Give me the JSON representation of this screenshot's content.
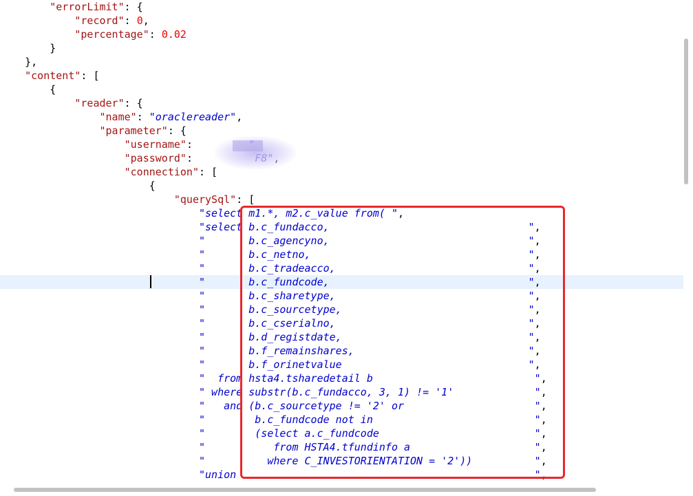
{
  "lines": [
    [
      {
        "t": "        "
      },
      {
        "c": "key",
        "t": "\"errorLimit\""
      },
      {
        "c": "punc",
        "t": ": {"
      }
    ],
    [
      {
        "t": "            "
      },
      {
        "c": "key",
        "t": "\"record\""
      },
      {
        "c": "punc",
        "t": ": "
      },
      {
        "c": "num",
        "t": "0"
      },
      {
        "c": "punc",
        "t": ","
      }
    ],
    [
      {
        "t": "            "
      },
      {
        "c": "key",
        "t": "\"percentage\""
      },
      {
        "c": "punc",
        "t": ": "
      },
      {
        "c": "num",
        "t": "0.02"
      }
    ],
    [
      {
        "t": "        "
      },
      {
        "c": "punc",
        "t": "}"
      }
    ],
    [
      {
        "t": "    "
      },
      {
        "c": "punc",
        "t": "},"
      }
    ],
    [
      {
        "t": "    "
      },
      {
        "c": "key",
        "t": "\"content\""
      },
      {
        "c": "punc",
        "t": ": ["
      }
    ],
    [
      {
        "t": "        "
      },
      {
        "c": "punc",
        "t": "{"
      }
    ],
    [
      {
        "t": "            "
      },
      {
        "c": "key",
        "t": "\"reader\""
      },
      {
        "c": "punc",
        "t": ": {"
      }
    ],
    [
      {
        "t": "                "
      },
      {
        "c": "key",
        "t": "\"name\""
      },
      {
        "c": "punc",
        "t": ": "
      },
      {
        "c": "str",
        "t": "\"oraclereader\""
      },
      {
        "c": "punc",
        "t": ","
      }
    ],
    [
      {
        "t": "                "
      },
      {
        "c": "key",
        "t": "\"parameter\""
      },
      {
        "c": "punc",
        "t": ": {"
      }
    ],
    [
      {
        "t": "                    "
      },
      {
        "c": "key",
        "t": "\"username\""
      },
      {
        "c": "punc",
        "t": ":"
      },
      {
        "t": "         "
      },
      {
        "c": "str",
        "t": "\""
      }
    ],
    [
      {
        "t": "                    "
      },
      {
        "c": "key",
        "t": "\"password\""
      },
      {
        "c": "punc",
        "t": ":"
      },
      {
        "t": "          "
      },
      {
        "c": "str",
        "t": "F8\""
      },
      {
        "c": "punc",
        "t": ","
      }
    ],
    [
      {
        "t": "                    "
      },
      {
        "c": "key",
        "t": "\"connection\""
      },
      {
        "c": "punc",
        "t": ": ["
      }
    ],
    [
      {
        "t": "                        "
      },
      {
        "c": "punc",
        "t": "{"
      }
    ],
    [
      {
        "t": "                            "
      },
      {
        "c": "key",
        "t": "\"querySql\""
      },
      {
        "c": "punc",
        "t": ": ["
      }
    ],
    [
      {
        "t": "                                "
      },
      {
        "c": "str",
        "t": "\"select m1.*, m2.c_value from( \""
      },
      {
        "c": "punc",
        "t": ","
      }
    ],
    [
      {
        "t": "                                "
      },
      {
        "c": "str",
        "t": "\"select b.c_fundacco,                                \""
      },
      {
        "c": "punc",
        "t": ","
      }
    ],
    [
      {
        "t": "                                "
      },
      {
        "c": "str",
        "t": "\"       b.c_agencyno,                                \""
      },
      {
        "c": "punc",
        "t": ","
      }
    ],
    [
      {
        "t": "                                "
      },
      {
        "c": "str",
        "t": "\"       b.c_netno,                                   \""
      },
      {
        "c": "punc",
        "t": ","
      }
    ],
    [
      {
        "t": "                                "
      },
      {
        "c": "str",
        "t": "\"       b.c_tradeacco,                               \""
      },
      {
        "c": "punc",
        "t": ","
      }
    ],
    [
      {
        "t": "                                "
      },
      {
        "c": "str",
        "t": "\"       b.c_fundcode,                                \""
      },
      {
        "c": "punc",
        "t": ","
      }
    ],
    [
      {
        "t": "                                "
      },
      {
        "c": "str",
        "t": "\"       b.c_sharetype,                               \""
      },
      {
        "c": "punc",
        "t": ","
      }
    ],
    [
      {
        "t": "                                "
      },
      {
        "c": "str",
        "t": "\"       b.c_sourcetype,                              \""
      },
      {
        "c": "punc",
        "t": ","
      }
    ],
    [
      {
        "t": "                                "
      },
      {
        "c": "str",
        "t": "\"       b.c_cserialno,                               \""
      },
      {
        "c": "punc",
        "t": ","
      }
    ],
    [
      {
        "t": "                                "
      },
      {
        "c": "str",
        "t": "\"       b.d_registdate,                              \""
      },
      {
        "c": "punc",
        "t": ","
      }
    ],
    [
      {
        "t": "                                "
      },
      {
        "c": "str",
        "t": "\"       b.f_remainshares,                            \""
      },
      {
        "c": "punc",
        "t": ","
      }
    ],
    [
      {
        "t": "                                "
      },
      {
        "c": "str",
        "t": "\"       b.f_orinetvalue                              \""
      },
      {
        "c": "punc",
        "t": ","
      }
    ],
    [
      {
        "t": "                                "
      },
      {
        "c": "str",
        "t": "\"  from hsta4.tsharedetail b                          \""
      },
      {
        "c": "punc",
        "t": ","
      }
    ],
    [
      {
        "t": "                                "
      },
      {
        "c": "str",
        "t": "\" where substr(b.c_fundacco, 3, 1) != '1'             \""
      },
      {
        "c": "punc",
        "t": ","
      }
    ],
    [
      {
        "t": "                                "
      },
      {
        "c": "str",
        "t": "\"   and (b.c_sourcetype != '2' or                     \""
      },
      {
        "c": "punc",
        "t": ","
      }
    ],
    [
      {
        "t": "                                "
      },
      {
        "c": "str",
        "t": "\"        b.c_fundcode not in                          \""
      },
      {
        "c": "punc",
        "t": ","
      }
    ],
    [
      {
        "t": "                                "
      },
      {
        "c": "str",
        "t": "\"        (select a.c_fundcode                         \""
      },
      {
        "c": "punc",
        "t": ","
      }
    ],
    [
      {
        "t": "                                "
      },
      {
        "c": "str",
        "t": "\"           from HSTA4.tfundinfo a                    \""
      },
      {
        "c": "punc",
        "t": ","
      }
    ],
    [
      {
        "t": "                                "
      },
      {
        "c": "str",
        "t": "\"          where C_INVESTORIENTATION = '2'))          \""
      },
      {
        "c": "punc",
        "t": ","
      }
    ],
    [
      {
        "t": "                                "
      },
      {
        "c": "str",
        "t": "\"union                                                \""
      },
      {
        "c": "punc",
        "t": ","
      }
    ]
  ]
}
